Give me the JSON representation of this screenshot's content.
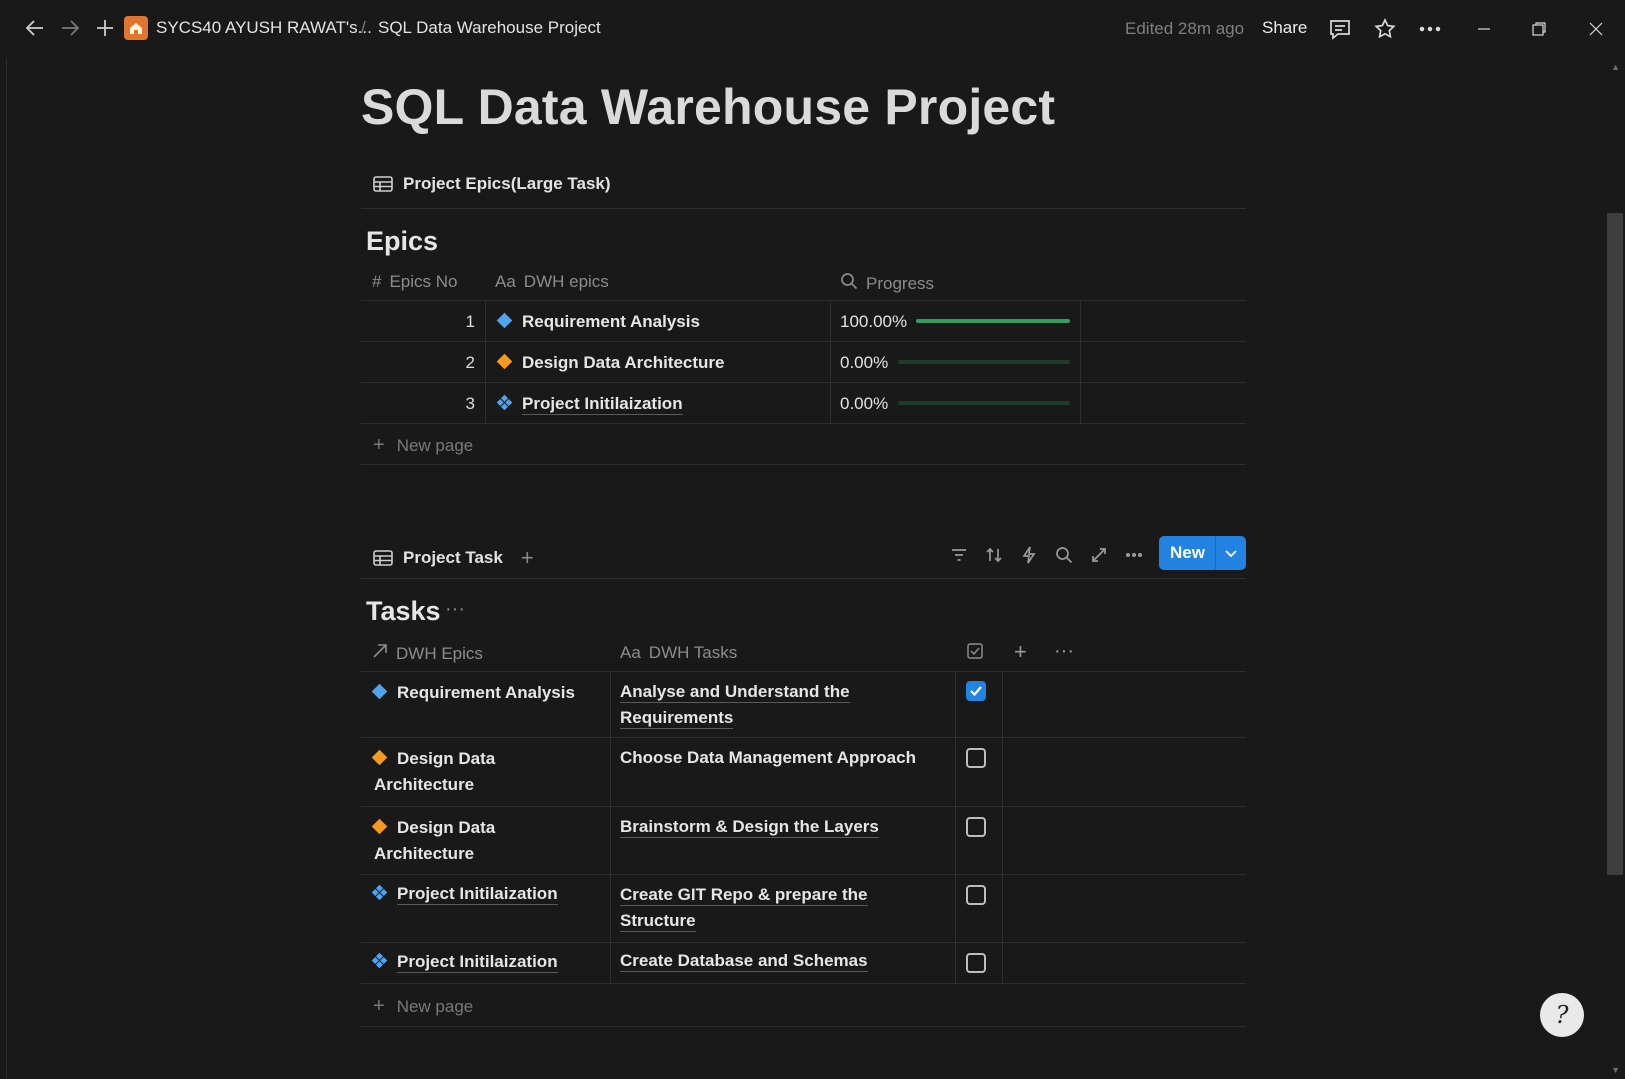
{
  "topbar": {
    "workspace": "SYCS40 AYUSH RAWAT's...",
    "separator": "/",
    "page": "SQL Data Warehouse Project",
    "edited": "Edited 28m ago",
    "share": "Share"
  },
  "page": {
    "title": "SQL Data Warehouse Project"
  },
  "epics_db": {
    "view_label": "Project Epics(Large Task)",
    "title": "Epics",
    "columns": {
      "number": "Epics No",
      "name": "DWH epics",
      "progress": "Progress"
    },
    "rows": [
      {
        "no": "1",
        "name": "Requirement Analysis",
        "progress_text": "100.00%",
        "progress": 1.0,
        "icon": "blue-diamond-icon"
      },
      {
        "no": "2",
        "name": "Design Data Architecture",
        "progress_text": "0.00%",
        "progress": 0.0,
        "icon": "orange-diamond-icon"
      },
      {
        "no": "3",
        "name": "Project Initilaization",
        "progress_text": "0.00%",
        "progress": 0.0,
        "icon": "blue-grid-diamond-icon"
      }
    ],
    "new_page": "New page"
  },
  "tasks_db": {
    "view_label": "Project Task",
    "new_button": "New",
    "title": "Tasks",
    "columns": {
      "epics": "DWH Epics",
      "tasks": "DWH Tasks"
    },
    "rows": [
      {
        "epic": "Requirement Analysis",
        "task": "Analyse and Understand the Requirements",
        "done": true,
        "icon": "blue-diamond-icon"
      },
      {
        "epic": "Design Data Architecture",
        "task": "Choose Data Management Approach",
        "done": false,
        "icon": "orange-diamond-icon"
      },
      {
        "epic": "Design Data Architecture",
        "task": "Brainstorm & Design the Layers",
        "done": false,
        "icon": "orange-diamond-icon"
      },
      {
        "epic": "Project Initilaization",
        "task": "Create GIT Repo & prepare the Structure",
        "done": false,
        "icon": "blue-grid-diamond-icon"
      },
      {
        "epic": "Project Initilaization",
        "task": "Create Database and Schemas",
        "done": false,
        "icon": "blue-grid-diamond-icon"
      }
    ],
    "new_page": "New page"
  },
  "colors": {
    "accent": "#2383e2",
    "progress_fill": "#2f9e5f",
    "background": "#191919"
  }
}
